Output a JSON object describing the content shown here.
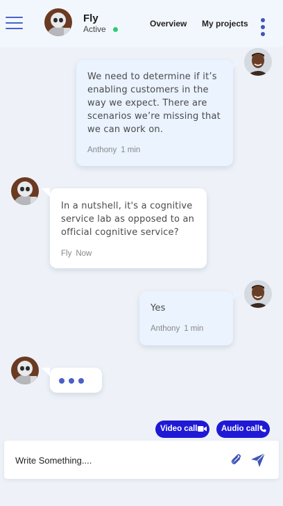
{
  "header": {
    "menu_icon": "hamburger-icon",
    "contact": {
      "name": "Fly",
      "status": "Active",
      "status_color": "#2ecc71"
    },
    "nav": [
      {
        "label": "Overview"
      },
      {
        "label": "My projects"
      }
    ],
    "more_icon": "kebab-menu-icon"
  },
  "messages": [
    {
      "direction": "outgoing",
      "text": "We need to determine if it’s enabling customers in the way we expect. There are scenarios we’re missing that we can work on.",
      "author": "Anthony",
      "time": "1 min"
    },
    {
      "direction": "incoming",
      "text": "In a nutshell, it's a cognitive service lab as opposed to an official cognitive service?",
      "author": "Fly",
      "time": "Now"
    },
    {
      "direction": "outgoing",
      "text": "Yes",
      "author": "Anthony",
      "time": "1 min"
    },
    {
      "direction": "incoming",
      "typing": true
    }
  ],
  "actions": {
    "video_call": {
      "label": "Video call",
      "icon": "video-camera-icon"
    },
    "audio_call": {
      "label": "Audio call",
      "icon": "phone-icon"
    }
  },
  "composer": {
    "placeholder": "Write Something....",
    "attach_icon": "paperclip-icon",
    "send_icon": "send-icon"
  },
  "colors": {
    "accent": "#1f19d6",
    "icon_blue": "#4a63c7",
    "outgoing_bubble": "#eaf3fe",
    "incoming_bubble": "#ffffff",
    "background": "#eef2f8"
  }
}
